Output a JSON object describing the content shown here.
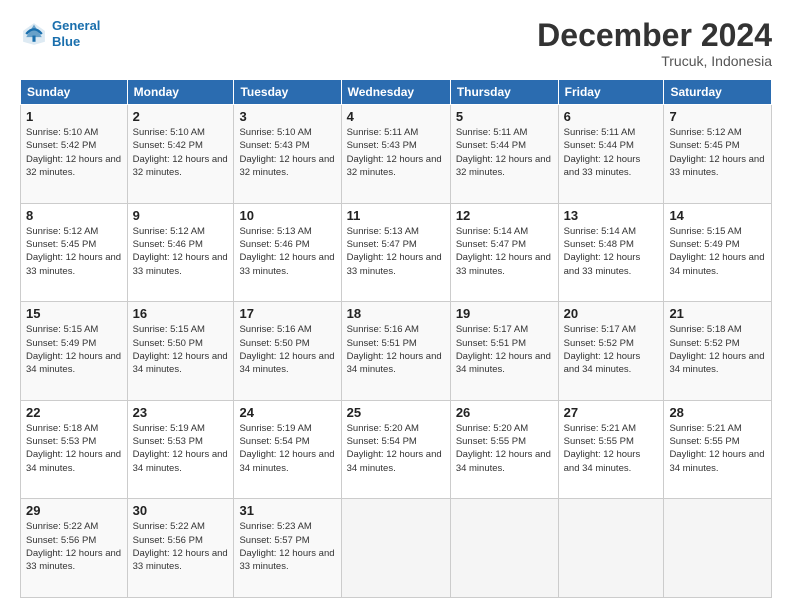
{
  "logo": {
    "line1": "General",
    "line2": "Blue"
  },
  "title": "December 2024",
  "location": "Trucuk, Indonesia",
  "header_days": [
    "Sunday",
    "Monday",
    "Tuesday",
    "Wednesday",
    "Thursday",
    "Friday",
    "Saturday"
  ],
  "weeks": [
    [
      {
        "day": "1",
        "sunrise": "5:10 AM",
        "sunset": "5:42 PM",
        "daylight": "12 hours and 32 minutes."
      },
      {
        "day": "2",
        "sunrise": "5:10 AM",
        "sunset": "5:42 PM",
        "daylight": "12 hours and 32 minutes."
      },
      {
        "day": "3",
        "sunrise": "5:10 AM",
        "sunset": "5:43 PM",
        "daylight": "12 hours and 32 minutes."
      },
      {
        "day": "4",
        "sunrise": "5:11 AM",
        "sunset": "5:43 PM",
        "daylight": "12 hours and 32 minutes."
      },
      {
        "day": "5",
        "sunrise": "5:11 AM",
        "sunset": "5:44 PM",
        "daylight": "12 hours and 32 minutes."
      },
      {
        "day": "6",
        "sunrise": "5:11 AM",
        "sunset": "5:44 PM",
        "daylight": "12 hours and 33 minutes."
      },
      {
        "day": "7",
        "sunrise": "5:12 AM",
        "sunset": "5:45 PM",
        "daylight": "12 hours and 33 minutes."
      }
    ],
    [
      {
        "day": "8",
        "sunrise": "5:12 AM",
        "sunset": "5:45 PM",
        "daylight": "12 hours and 33 minutes."
      },
      {
        "day": "9",
        "sunrise": "5:12 AM",
        "sunset": "5:46 PM",
        "daylight": "12 hours and 33 minutes."
      },
      {
        "day": "10",
        "sunrise": "5:13 AM",
        "sunset": "5:46 PM",
        "daylight": "12 hours and 33 minutes."
      },
      {
        "day": "11",
        "sunrise": "5:13 AM",
        "sunset": "5:47 PM",
        "daylight": "12 hours and 33 minutes."
      },
      {
        "day": "12",
        "sunrise": "5:14 AM",
        "sunset": "5:47 PM",
        "daylight": "12 hours and 33 minutes."
      },
      {
        "day": "13",
        "sunrise": "5:14 AM",
        "sunset": "5:48 PM",
        "daylight": "12 hours and 33 minutes."
      },
      {
        "day": "14",
        "sunrise": "5:15 AM",
        "sunset": "5:49 PM",
        "daylight": "12 hours and 34 minutes."
      }
    ],
    [
      {
        "day": "15",
        "sunrise": "5:15 AM",
        "sunset": "5:49 PM",
        "daylight": "12 hours and 34 minutes."
      },
      {
        "day": "16",
        "sunrise": "5:15 AM",
        "sunset": "5:50 PM",
        "daylight": "12 hours and 34 minutes."
      },
      {
        "day": "17",
        "sunrise": "5:16 AM",
        "sunset": "5:50 PM",
        "daylight": "12 hours and 34 minutes."
      },
      {
        "day": "18",
        "sunrise": "5:16 AM",
        "sunset": "5:51 PM",
        "daylight": "12 hours and 34 minutes."
      },
      {
        "day": "19",
        "sunrise": "5:17 AM",
        "sunset": "5:51 PM",
        "daylight": "12 hours and 34 minutes."
      },
      {
        "day": "20",
        "sunrise": "5:17 AM",
        "sunset": "5:52 PM",
        "daylight": "12 hours and 34 minutes."
      },
      {
        "day": "21",
        "sunrise": "5:18 AM",
        "sunset": "5:52 PM",
        "daylight": "12 hours and 34 minutes."
      }
    ],
    [
      {
        "day": "22",
        "sunrise": "5:18 AM",
        "sunset": "5:53 PM",
        "daylight": "12 hours and 34 minutes."
      },
      {
        "day": "23",
        "sunrise": "5:19 AM",
        "sunset": "5:53 PM",
        "daylight": "12 hours and 34 minutes."
      },
      {
        "day": "24",
        "sunrise": "5:19 AM",
        "sunset": "5:54 PM",
        "daylight": "12 hours and 34 minutes."
      },
      {
        "day": "25",
        "sunrise": "5:20 AM",
        "sunset": "5:54 PM",
        "daylight": "12 hours and 34 minutes."
      },
      {
        "day": "26",
        "sunrise": "5:20 AM",
        "sunset": "5:55 PM",
        "daylight": "12 hours and 34 minutes."
      },
      {
        "day": "27",
        "sunrise": "5:21 AM",
        "sunset": "5:55 PM",
        "daylight": "12 hours and 34 minutes."
      },
      {
        "day": "28",
        "sunrise": "5:21 AM",
        "sunset": "5:55 PM",
        "daylight": "12 hours and 34 minutes."
      }
    ],
    [
      {
        "day": "29",
        "sunrise": "5:22 AM",
        "sunset": "5:56 PM",
        "daylight": "12 hours and 33 minutes."
      },
      {
        "day": "30",
        "sunrise": "5:22 AM",
        "sunset": "5:56 PM",
        "daylight": "12 hours and 33 minutes."
      },
      {
        "day": "31",
        "sunrise": "5:23 AM",
        "sunset": "5:57 PM",
        "daylight": "12 hours and 33 minutes."
      },
      null,
      null,
      null,
      null
    ]
  ],
  "labels": {
    "sunrise": "Sunrise:",
    "sunset": "Sunset:",
    "daylight": "Daylight:"
  }
}
